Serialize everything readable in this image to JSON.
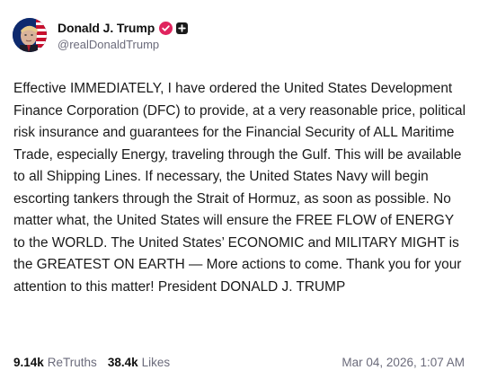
{
  "author": {
    "display_name": "Donald J. Trump",
    "handle": "@realDonaldTrump",
    "avatar_icon": "avatar-portrait-flag",
    "verified_icon": "verified-check-icon",
    "verified_color": "#e0245e",
    "badge_icon": "plus-badge-icon"
  },
  "post": {
    "text": "Effective IMMEDIATELY, I have ordered the United States Development Finance Corporation (DFC) to provide, at a very reasonable price, political risk insurance and guarantees for the Financial Security of ALL Maritime Trade, especially Energy, traveling through the Gulf. This will be available to all Shipping Lines. If necessary, the United States Navy will begin escorting tankers through the Strait of Hormuz, as soon as possible. No matter what, the United States will ensure the FREE FLOW of ENERGY to the WORLD. The United States’ ECONOMIC and MILITARY MIGHT is the GREATEST ON EARTH — More actions to come. Thank you for your attention to this matter! President DONALD J. TRUMP"
  },
  "stats": {
    "retruths_count": "9.14k",
    "retruths_label": "ReTruths",
    "likes_count": "38.4k",
    "likes_label": "Likes"
  },
  "timestamp": "Mar 04, 2026, 1:07 AM"
}
